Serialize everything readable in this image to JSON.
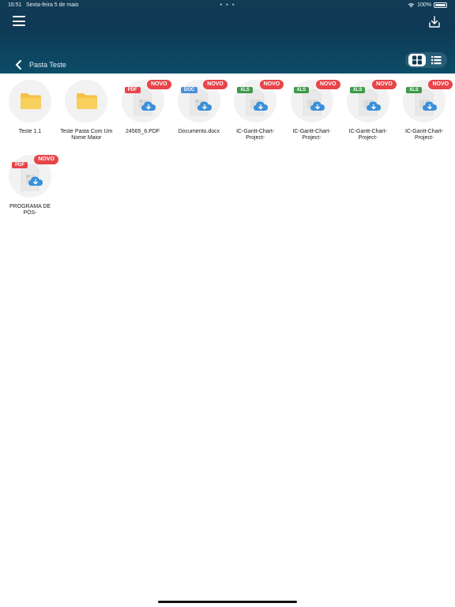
{
  "status_bar": {
    "time": "16:51",
    "date": "Sexta-feira 5 de maio",
    "dots": "• • •",
    "battery": "100%"
  },
  "header": {
    "breadcrumb": "Pasta Teste",
    "view_mode": "grid"
  },
  "badge_label": "NOVO",
  "colors": {
    "header": "#0e3a55",
    "novo": "#e8454a",
    "pdf": "#e8454a",
    "doc": "#4a8fd6",
    "xls": "#3f9a4a",
    "folder": "#f7c046",
    "cloud": "#3b8fd8"
  },
  "items": [
    {
      "type": "folder",
      "name": "Teste 1.1",
      "new": false
    },
    {
      "type": "folder",
      "name": "Teste Pasta Com Um Nome Maior",
      "new": false
    },
    {
      "type": "pdf",
      "tag": "PDF",
      "name": "24565_6.PDF",
      "new": true
    },
    {
      "type": "doc",
      "tag": "DOC",
      "name": "Documento.docx",
      "new": true
    },
    {
      "type": "xls",
      "tag": "XLS",
      "name": "IC-Gantt-Chart-Project-",
      "new": true
    },
    {
      "type": "xls",
      "tag": "XLS",
      "name": "IC-Gantt-Chart-Project-",
      "new": true
    },
    {
      "type": "xls",
      "tag": "XLS",
      "name": "IC-Gantt-Chart-Project-",
      "new": true
    },
    {
      "type": "xls",
      "tag": "XLS",
      "name": "IC-Gantt-Chart-Project-",
      "new": true
    },
    {
      "type": "pdf",
      "tag": "PDF",
      "name": "PROGRAMA DE PÓS-",
      "new": true
    }
  ]
}
